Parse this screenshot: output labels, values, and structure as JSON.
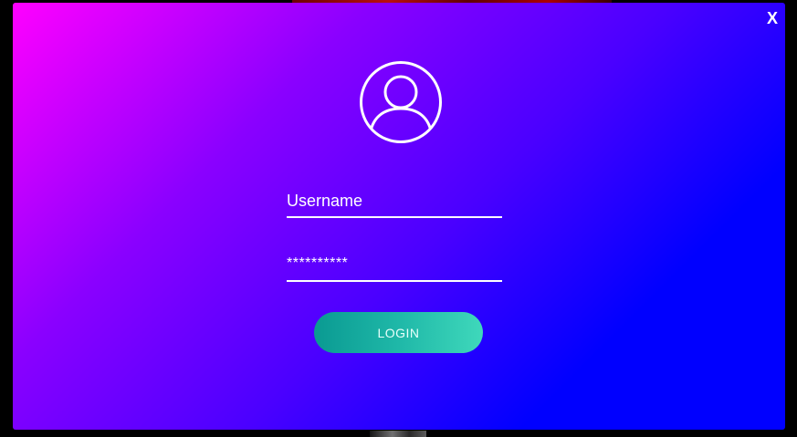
{
  "modal": {
    "close_label": "X"
  },
  "avatar": {
    "icon": "user-circle-icon"
  },
  "form": {
    "username_placeholder": "Username",
    "password_display": "**********",
    "login_label": "LOGIN"
  },
  "colors": {
    "modal_gradient_start": "#ff00ff",
    "modal_gradient_end": "#0000ff",
    "button_gradient_start": "#0a9a92",
    "button_gradient_end": "#3fd8bb",
    "text": "#ffffff"
  }
}
